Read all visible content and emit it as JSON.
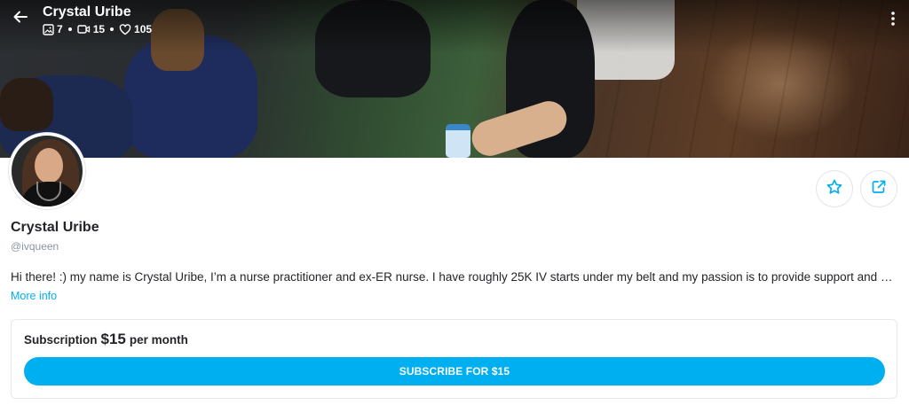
{
  "header": {
    "title": "Crystal Uribe",
    "stats": {
      "photos": "7",
      "videos": "15",
      "likes": "105"
    },
    "icons": {
      "back": "arrow-left-icon",
      "photos": "image-icon",
      "videos": "video-icon",
      "likes": "heart-icon",
      "more": "more-vertical-icon"
    }
  },
  "profile": {
    "name": "Crystal Uribe",
    "handle": "@ivqueen",
    "bio": "Hi there! :) my name is Crystal Uribe, I’m a nurse practitioner and ex-ER nurse. I have roughly 25K IV starts under my belt and my passion is to provide support and education to nurses and clinicians",
    "more_info": "More info",
    "actions": {
      "favorite_icon": "star-icon",
      "share_icon": "share-icon"
    }
  },
  "subscription": {
    "label": "Subscription",
    "price": "$15",
    "period": "per month",
    "button_label": "SUBSCRIBE FOR $15"
  },
  "colors": {
    "accent": "#00aff0",
    "text": "#242529",
    "muted": "#8a96a3",
    "border": "#e6e8ec"
  }
}
